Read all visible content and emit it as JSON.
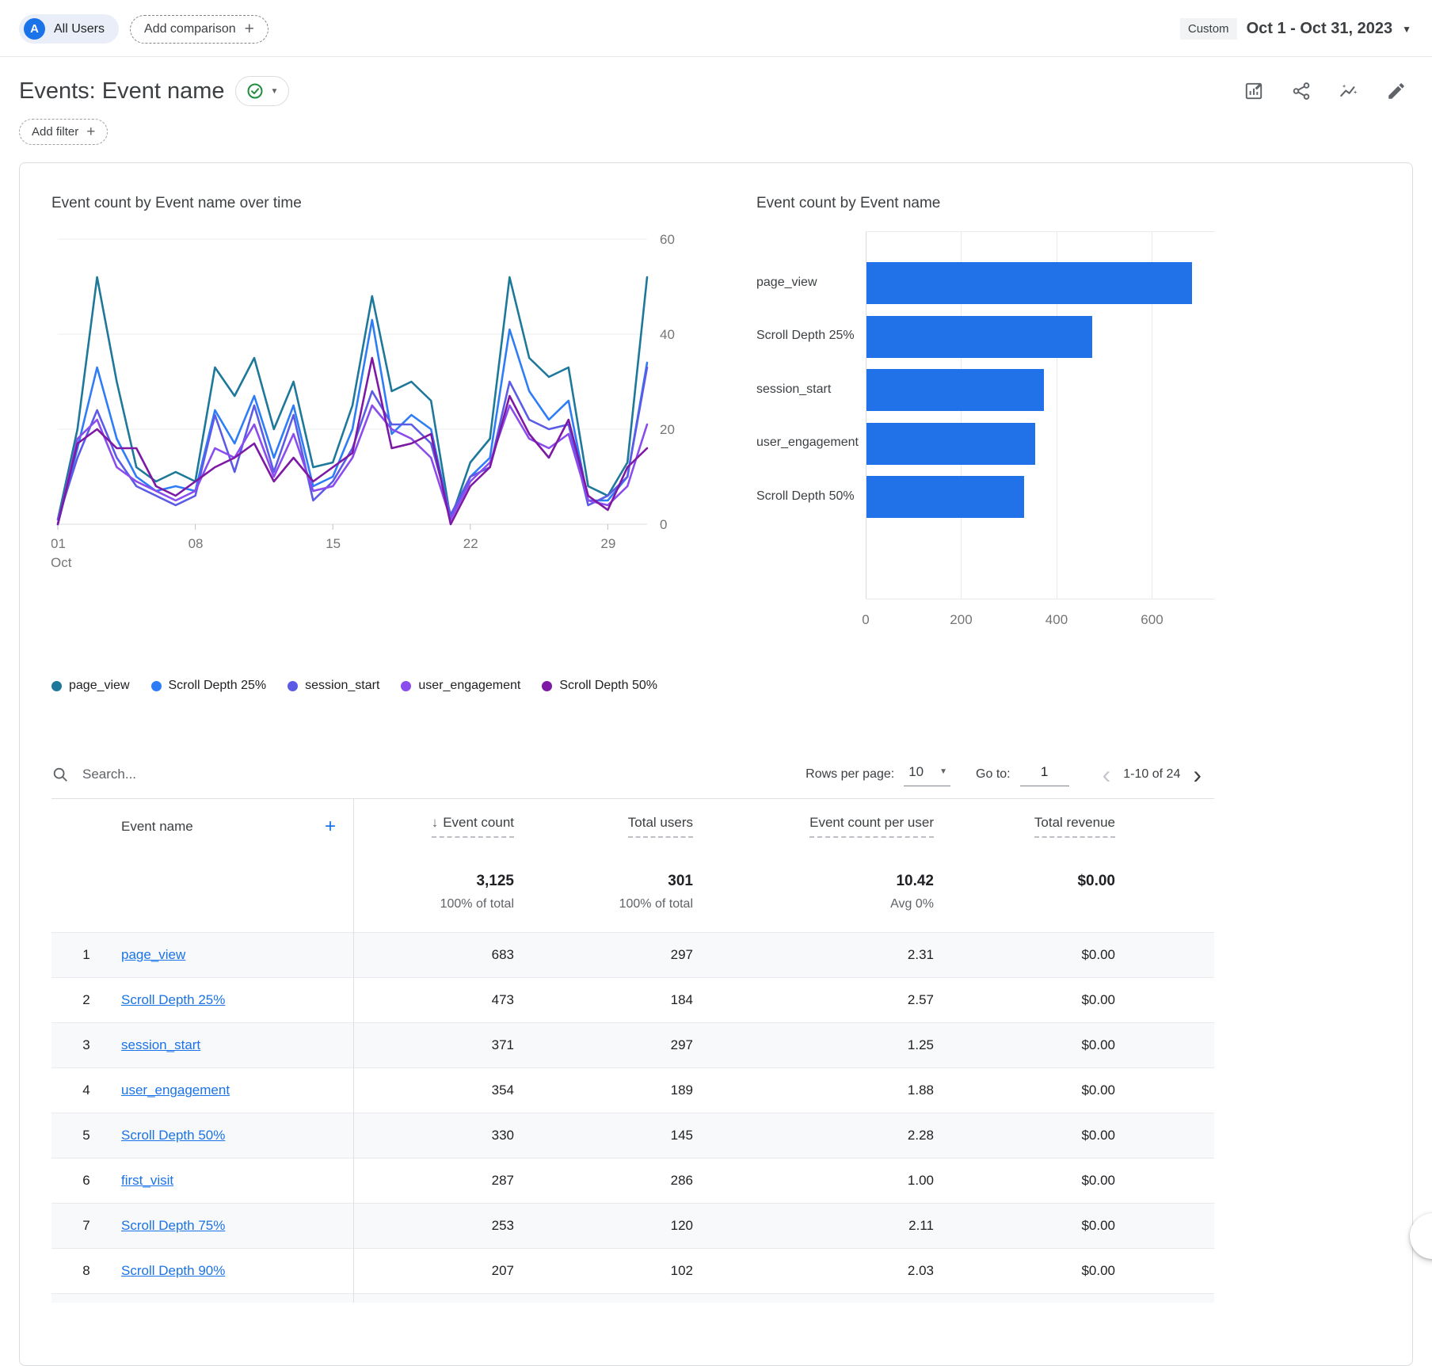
{
  "icons": {
    "plus": "+",
    "caret_down": "▾",
    "caret_down_big": "▼",
    "chevron_left": "‹",
    "chevron_right": "›",
    "sort_desc": "↓"
  },
  "header": {
    "avatar_letter": "A",
    "all_users_label": "All Users",
    "add_comparison_label": "Add comparison",
    "date_range_type": "Custom",
    "date_range": "Oct 1 - Oct 31, 2023"
  },
  "title": {
    "text": "Events: Event name"
  },
  "filter": {
    "add_filter_label": "Add filter"
  },
  "colors": {
    "accent": "#1a73e8",
    "bar": "#2172e8",
    "link": "#1a73e8",
    "check": "#1e8e3e"
  },
  "chart_data": [
    {
      "type": "line",
      "title": "Event count by Event name over time",
      "x": [
        "01",
        "02",
        "03",
        "04",
        "05",
        "06",
        "07",
        "08",
        "09",
        "10",
        "11",
        "12",
        "13",
        "14",
        "15",
        "16",
        "17",
        "18",
        "19",
        "20",
        "21",
        "22",
        "23",
        "24",
        "25",
        "26",
        "27",
        "28",
        "29",
        "30",
        "31"
      ],
      "xtick_idx": [
        0,
        7,
        14,
        21,
        28
      ],
      "xtick_labels": [
        "01",
        "08",
        "15",
        "22",
        "29"
      ],
      "month_label": "Oct",
      "ylim": [
        0,
        60
      ],
      "yticks": [
        0,
        20,
        40,
        60
      ],
      "grid": true,
      "legend_position": "bottom",
      "series": [
        {
          "name": "page_view",
          "color": "#1d7899",
          "values": [
            1,
            20,
            52,
            30,
            12,
            9,
            11,
            9,
            33,
            27,
            35,
            20,
            30,
            12,
            13,
            25,
            48,
            28,
            30,
            26,
            1,
            13,
            18,
            52,
            35,
            31,
            33,
            8,
            6,
            13,
            52
          ]
        },
        {
          "name": "Scroll Depth 25%",
          "color": "#2e7df6",
          "values": [
            0,
            16,
            33,
            18,
            10,
            7,
            8,
            7,
            24,
            17,
            27,
            14,
            25,
            8,
            10,
            20,
            43,
            19,
            23,
            20,
            1,
            10,
            14,
            41,
            28,
            22,
            26,
            5,
            5,
            10,
            34
          ]
        },
        {
          "name": "session_start",
          "color": "#5b5be6",
          "values": [
            1,
            14,
            24,
            14,
            8,
            6,
            4,
            6,
            23,
            11,
            25,
            11,
            23,
            5,
            9,
            16,
            28,
            21,
            21,
            17,
            2,
            10,
            12,
            30,
            22,
            20,
            21,
            4,
            6,
            10,
            33
          ]
        },
        {
          "name": "user_engagement",
          "color": "#8b4ced",
          "values": [
            0,
            18,
            22,
            12,
            9,
            7,
            5,
            7,
            16,
            14,
            21,
            10,
            19,
            7,
            8,
            14,
            25,
            20,
            18,
            14,
            1,
            9,
            13,
            25,
            18,
            16,
            19,
            5,
            4,
            8,
            21
          ]
        },
        {
          "name": "Scroll Depth 50%",
          "color": "#7d19a4",
          "values": [
            0,
            17,
            20,
            16,
            16,
            8,
            6,
            9,
            12,
            14,
            17,
            9,
            14,
            9,
            12,
            15,
            35,
            16,
            17,
            19,
            0,
            8,
            12,
            27,
            19,
            14,
            22,
            6,
            3,
            12,
            16
          ]
        }
      ]
    },
    {
      "type": "bar",
      "title": "Event count by Event name",
      "orientation": "horizontal",
      "categories": [
        "page_view",
        "Scroll Depth 25%",
        "session_start",
        "user_engagement",
        "Scroll Depth 50%"
      ],
      "values": [
        683,
        473,
        371,
        354,
        330
      ],
      "xticks": [
        0,
        200,
        400,
        600
      ],
      "xmax": 727,
      "bar_color": "#2172e8"
    }
  ],
  "table": {
    "search_placeholder": "Search...",
    "rows_per_page_label": "Rows per page:",
    "rows_per_page_value": "10",
    "goto_label": "Go to:",
    "goto_value": "1",
    "range_label": "1-10 of 24",
    "columns": [
      "Event name",
      "Event count",
      "Total users",
      "Event count per user",
      "Total revenue"
    ],
    "totals": {
      "event_count": "3,125",
      "event_count_sub": "100% of total",
      "total_users": "301",
      "total_users_sub": "100% of total",
      "per_user": "10.42",
      "per_user_sub": "Avg 0%",
      "revenue": "$0.00"
    },
    "rows": [
      {
        "num": "1",
        "name": "page_view",
        "event_count": "683",
        "total_users": "297",
        "per_user": "2.31",
        "revenue": "$0.00"
      },
      {
        "num": "2",
        "name": "Scroll Depth 25%",
        "event_count": "473",
        "total_users": "184",
        "per_user": "2.57",
        "revenue": "$0.00"
      },
      {
        "num": "3",
        "name": "session_start",
        "event_count": "371",
        "total_users": "297",
        "per_user": "1.25",
        "revenue": "$0.00"
      },
      {
        "num": "4",
        "name": "user_engagement",
        "event_count": "354",
        "total_users": "189",
        "per_user": "1.88",
        "revenue": "$0.00"
      },
      {
        "num": "5",
        "name": "Scroll Depth 50%",
        "event_count": "330",
        "total_users": "145",
        "per_user": "2.28",
        "revenue": "$0.00"
      },
      {
        "num": "6",
        "name": "first_visit",
        "event_count": "287",
        "total_users": "286",
        "per_user": "1.00",
        "revenue": "$0.00"
      },
      {
        "num": "7",
        "name": "Scroll Depth 75%",
        "event_count": "253",
        "total_users": "120",
        "per_user": "2.11",
        "revenue": "$0.00"
      },
      {
        "num": "8",
        "name": "Scroll Depth 90%",
        "event_count": "207",
        "total_users": "102",
        "per_user": "2.03",
        "revenue": "$0.00"
      }
    ]
  }
}
